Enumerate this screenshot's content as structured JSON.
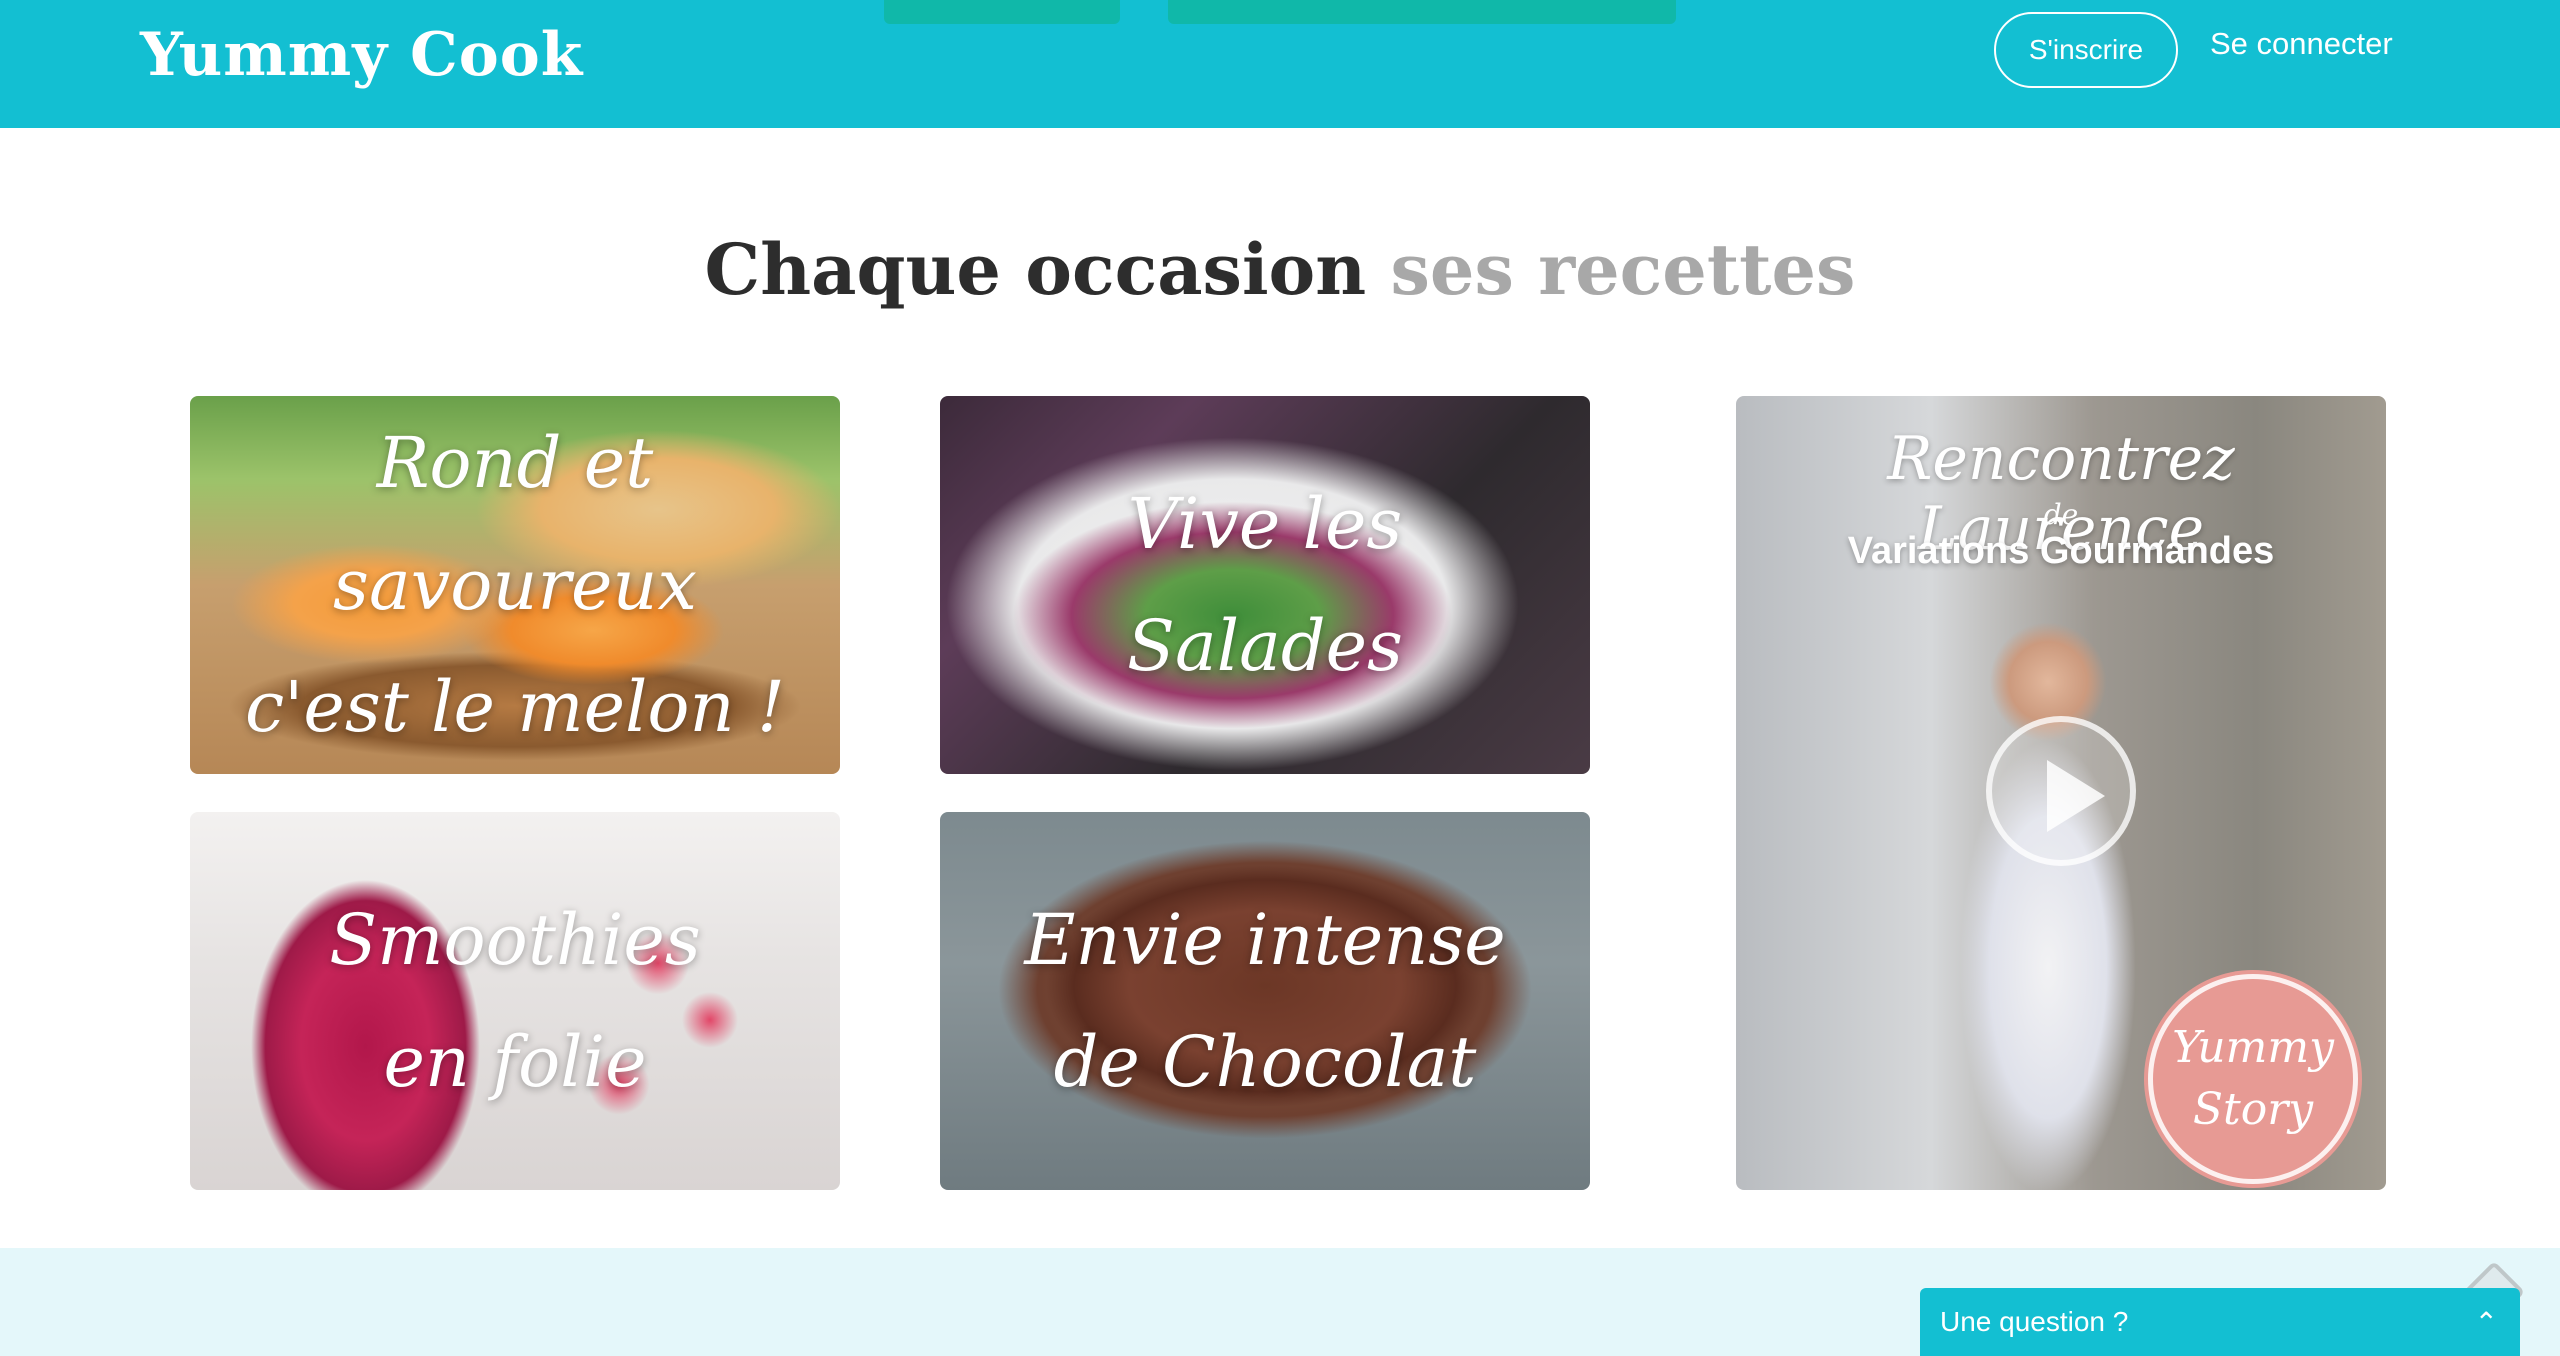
{
  "header": {
    "brand": "Yummy Cook",
    "signup_label": "S'inscrire",
    "login_label": "Se connecter"
  },
  "section": {
    "title_dark": "Chaque occasion",
    "title_light": "ses recettes"
  },
  "cards": [
    {
      "line1": "Rond et savoureux",
      "line2": "c'est le melon !"
    },
    {
      "line1": "Vive les",
      "line2": "Salades"
    },
    {
      "line1": "Smoothies",
      "line2": "en folie"
    },
    {
      "line1": "Envie intense",
      "line2": "de Chocolat"
    }
  ],
  "video": {
    "title": "Rencontrez Laurence",
    "de": "de",
    "subtitle": "Variations Gourmandes",
    "badge_line1": "Yummy",
    "badge_line2": "Story"
  },
  "chat": {
    "label": "Une question ?"
  },
  "colors": {
    "brand_teal": "#13bfd2",
    "band_light": "#e4f7fa",
    "heading_dark": "#2d2d2d",
    "heading_light": "#a8a8a8"
  },
  "icons": [
    "play-icon",
    "chevron-up-icon",
    "diamond-icon"
  ]
}
